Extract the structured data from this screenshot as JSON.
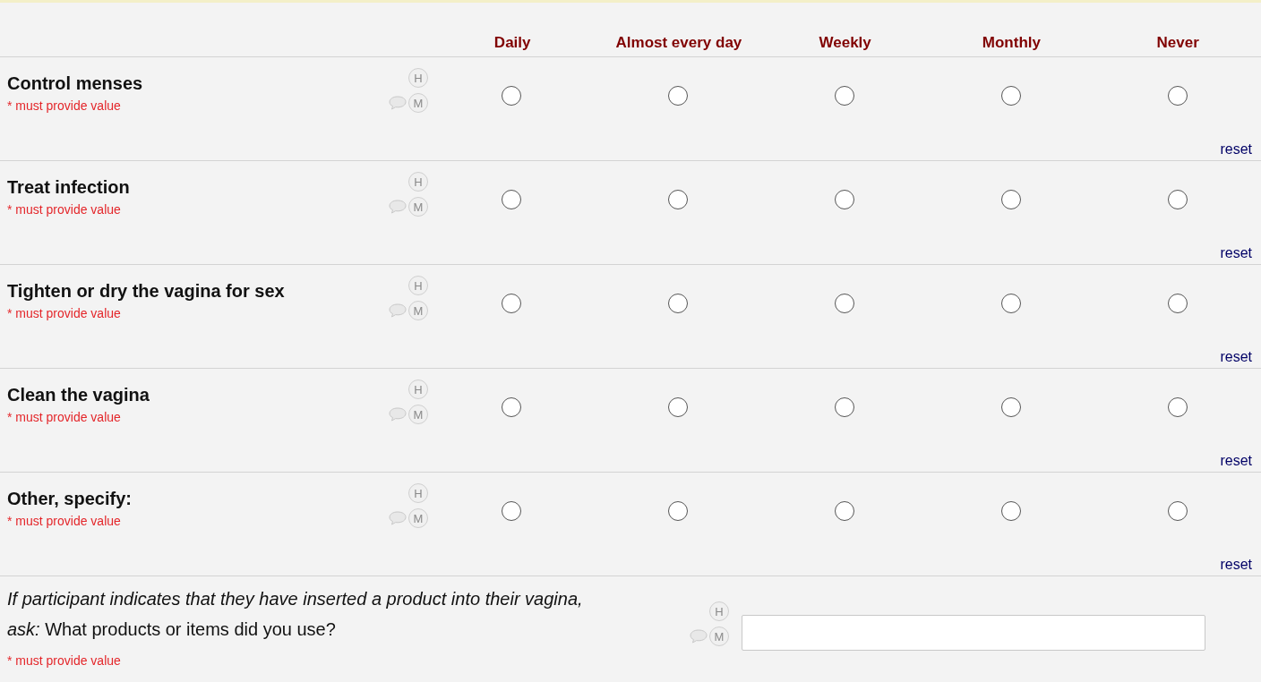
{
  "columns": [
    "Daily",
    "Almost every day",
    "Weekly",
    "Monthly",
    "Never"
  ],
  "rows": [
    {
      "label": "Control menses",
      "required": "* must provide value",
      "history": "H",
      "missing": "M",
      "reset": "reset",
      "choices": [
        {
          "selected": false
        },
        {
          "selected": false
        },
        {
          "selected": false
        },
        {
          "selected": false
        },
        {
          "selected": false
        }
      ]
    },
    {
      "label": "Treat infection",
      "required": "* must provide value",
      "history": "H",
      "missing": "M",
      "reset": "reset",
      "choices": [
        {
          "selected": false
        },
        {
          "selected": false
        },
        {
          "selected": false
        },
        {
          "selected": false
        },
        {
          "selected": false
        }
      ]
    },
    {
      "label": "Tighten or dry the vagina for sex",
      "required": "* must provide value",
      "history": "H",
      "missing": "M",
      "reset": "reset",
      "choices": [
        {
          "selected": false
        },
        {
          "selected": false
        },
        {
          "selected": false
        },
        {
          "selected": false
        },
        {
          "selected": false
        }
      ]
    },
    {
      "label": "Clean the vagina",
      "required": "* must provide value",
      "history": "H",
      "missing": "M",
      "reset": "reset",
      "choices": [
        {
          "selected": false
        },
        {
          "selected": false
        },
        {
          "selected": false
        },
        {
          "selected": false
        },
        {
          "selected": false
        }
      ]
    },
    {
      "label": "Other, specify:",
      "required": "* must provide value",
      "history": "H",
      "missing": "M",
      "reset": "reset",
      "choices": [
        {
          "selected": false
        },
        {
          "selected": false
        },
        {
          "selected": false
        },
        {
          "selected": false
        },
        {
          "selected": false
        }
      ]
    }
  ],
  "text_question": {
    "label": "*If participant indicates that they have inserted a product into their vagina, ask:* What products or items did you use?",
    "required": "* must provide value",
    "history": "H",
    "missing": "M"
  }
}
